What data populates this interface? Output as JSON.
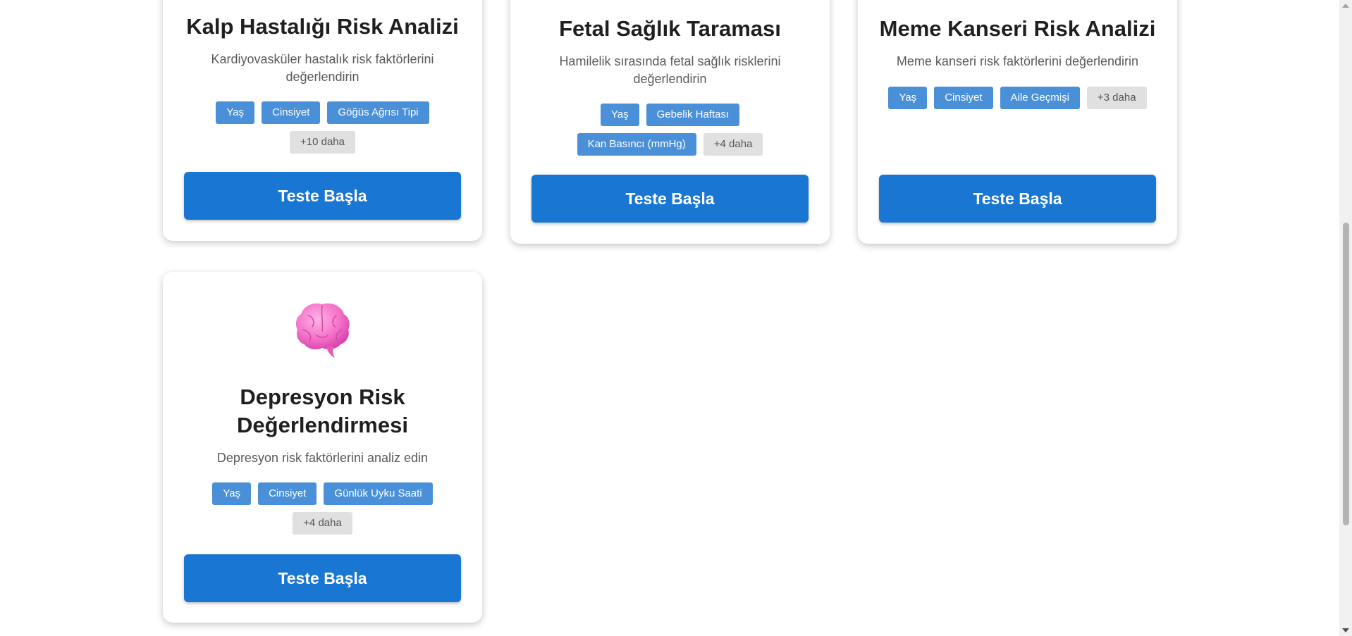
{
  "cards": [
    {
      "title": "Kalp Hastalığı Risk Analizi",
      "description": "Kardiyovasküler hastalık risk faktörlerini değerlendirin",
      "tags": [
        "Yaş",
        "Cinsiyet",
        "Göğüs Ağrısı Tipi"
      ],
      "more": "+10 daha",
      "button": "Teste Başla"
    },
    {
      "title": "Fetal Sağlık Taraması",
      "description": "Hamilelik sırasında fetal sağlık risklerini değerlendirin",
      "tags": [
        "Yaş",
        "Gebelik Haftası",
        "Kan Basıncı (mmHg)"
      ],
      "more": "+4 daha",
      "button": "Teste Başla"
    },
    {
      "title": "Meme Kanseri Risk Analizi",
      "description": "Meme kanseri risk faktörlerini değerlendirin",
      "tags": [
        "Yaş",
        "Cinsiyet",
        "Aile Geçmişi"
      ],
      "more": "+3 daha",
      "button": "Teste Başla"
    },
    {
      "icon": "brain-icon",
      "title": "Depresyon Risk Değerlendirmesi",
      "description": "Depresyon risk faktörlerini analiz edin",
      "tags": [
        "Yaş",
        "Cinsiyet",
        "Günlük Uyku Saati"
      ],
      "more": "+4 daha",
      "button": "Teste Başla"
    }
  ],
  "colors": {
    "primary_button": "#1976d2",
    "tag": "#4a90d9",
    "tag_more": "#e0e0e0"
  }
}
